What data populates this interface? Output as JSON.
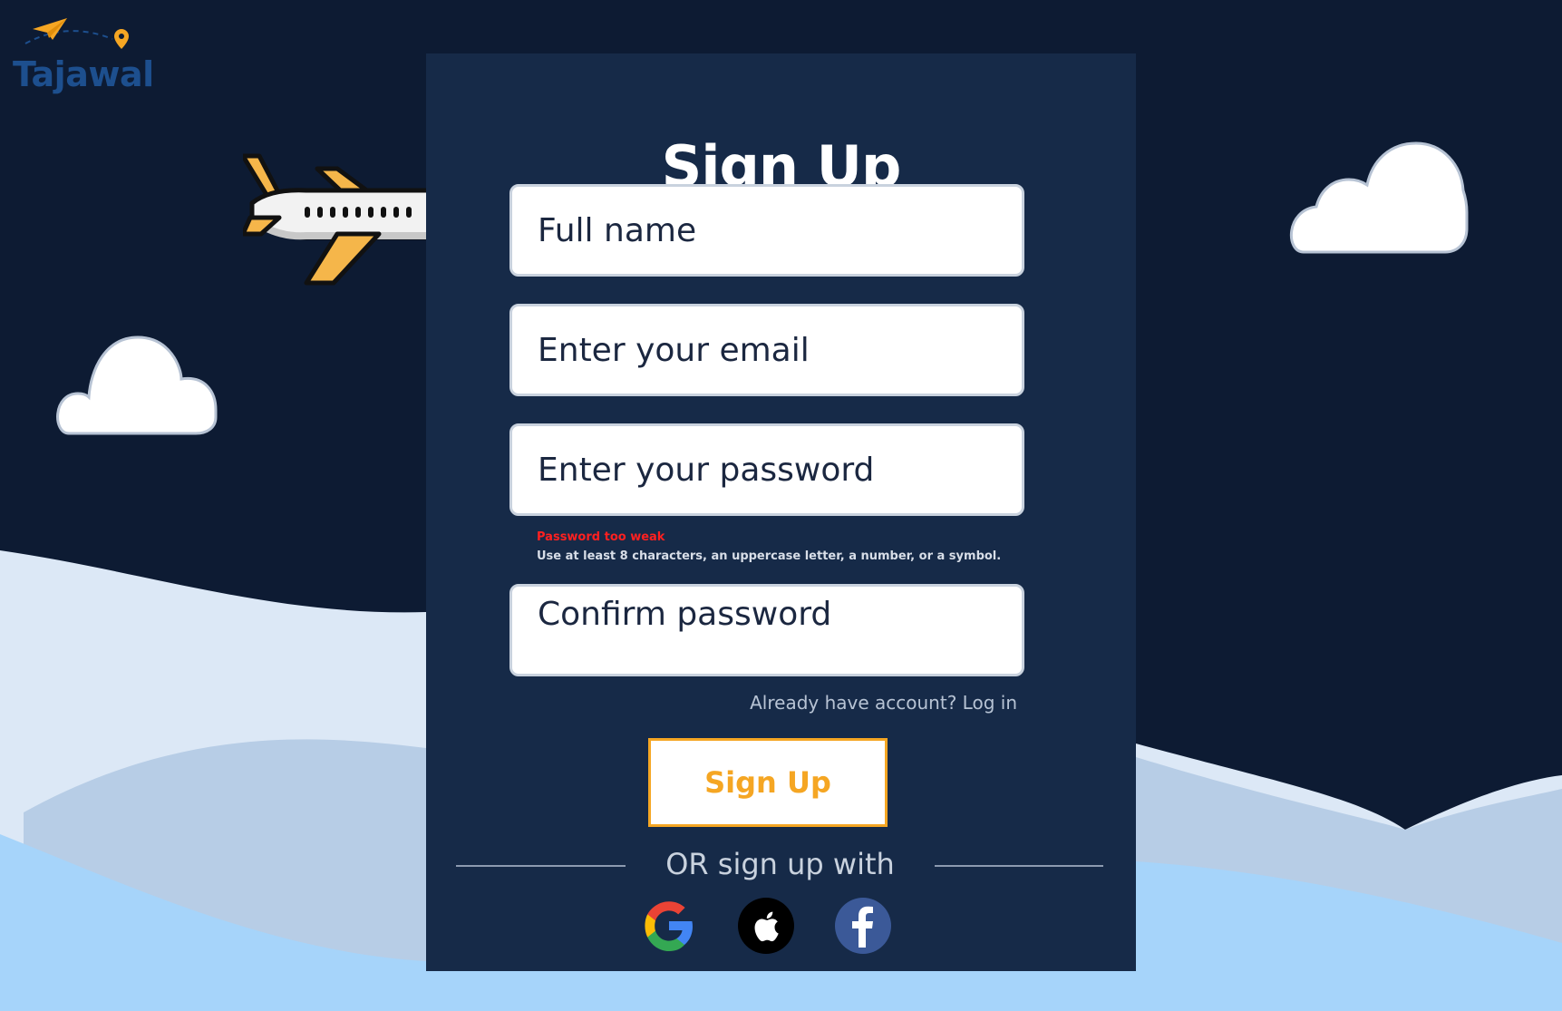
{
  "brand": {
    "name": "Tajawal"
  },
  "colors": {
    "sky": "#0d1b33",
    "card": "#162a48",
    "accent": "#f5a623",
    "error": "#ff2020"
  },
  "form": {
    "title": "Sign Up",
    "full_name": {
      "placeholder": "Full name",
      "value": ""
    },
    "email": {
      "placeholder": "Enter your email",
      "value": ""
    },
    "password": {
      "placeholder": "Enter your password",
      "value": ""
    },
    "password_error": "Password too weak",
    "password_hint": "Use at least 8 characters, an uppercase letter, a number, or a symbol.",
    "confirm_password": {
      "placeholder": "Confirm password",
      "value": ""
    },
    "login_link": "Already have account? Log in",
    "submit_label": "Sign Up"
  },
  "social": {
    "divider_text": "OR sign up with",
    "providers": [
      {
        "icon": "google-icon"
      },
      {
        "icon": "apple-icon"
      },
      {
        "icon": "facebook-icon"
      }
    ]
  }
}
